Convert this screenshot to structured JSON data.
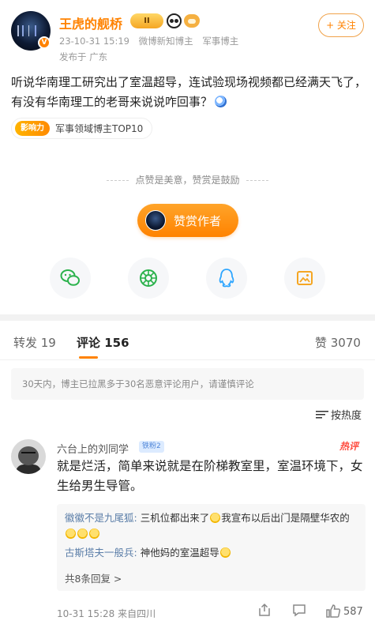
{
  "author": {
    "name": "王虎的舰桥",
    "medal_label": "II",
    "verified_label": "V",
    "time": "23-10-31 15:19",
    "tags": [
      "微博新知博主",
      "军事博主"
    ],
    "location": "发布于 广东",
    "follow_label": "+ 关注"
  },
  "post": {
    "text": "听说华南理工研究出了室温超导，连试验现场视频都已经满天飞了，有没有华南理工的老哥来说说咋回事？",
    "badge_tag": "影响力",
    "badge_text": "军事领域博主TOP10"
  },
  "reward": {
    "hint": "点赞是美意，赞赏是鼓励",
    "button_label": "赞赏作者"
  },
  "share": {
    "icons": [
      "wechat-icon",
      "moments-icon",
      "qq-icon",
      "save-image-icon"
    ]
  },
  "tabs": {
    "repost": "转发 19",
    "comments": "评论 156",
    "likes": "赞 3070"
  },
  "notice": "30天内，博主已拉黑多于30名恶意评论用户，请谨慎评论",
  "sort": {
    "label": "按热度"
  },
  "comment": {
    "name": "六台上的刘同学",
    "fan_badge": "铁粉2",
    "hot_label": "热评",
    "text": "就是烂活，简单来说就是在阶梯教室里，室温环境下，女生给男生导管。",
    "replies": [
      {
        "who": "徽徽不是九尾狐:",
        "text_a": " 三机位都出来了",
        "text_b": "我宣布以后出门是隔壁华农的"
      },
      {
        "who": "古斯塔夫一般兵:",
        "text_a": " 神他妈的室温超导",
        "text_b": ""
      }
    ],
    "more_replies": "共8条回复 >",
    "footer": "10-31 15:28  来自四川",
    "like_count": "587"
  },
  "colors": {
    "accent": "#ff8200",
    "link": "#5b7ea8",
    "hot": "#ff4a3d"
  }
}
